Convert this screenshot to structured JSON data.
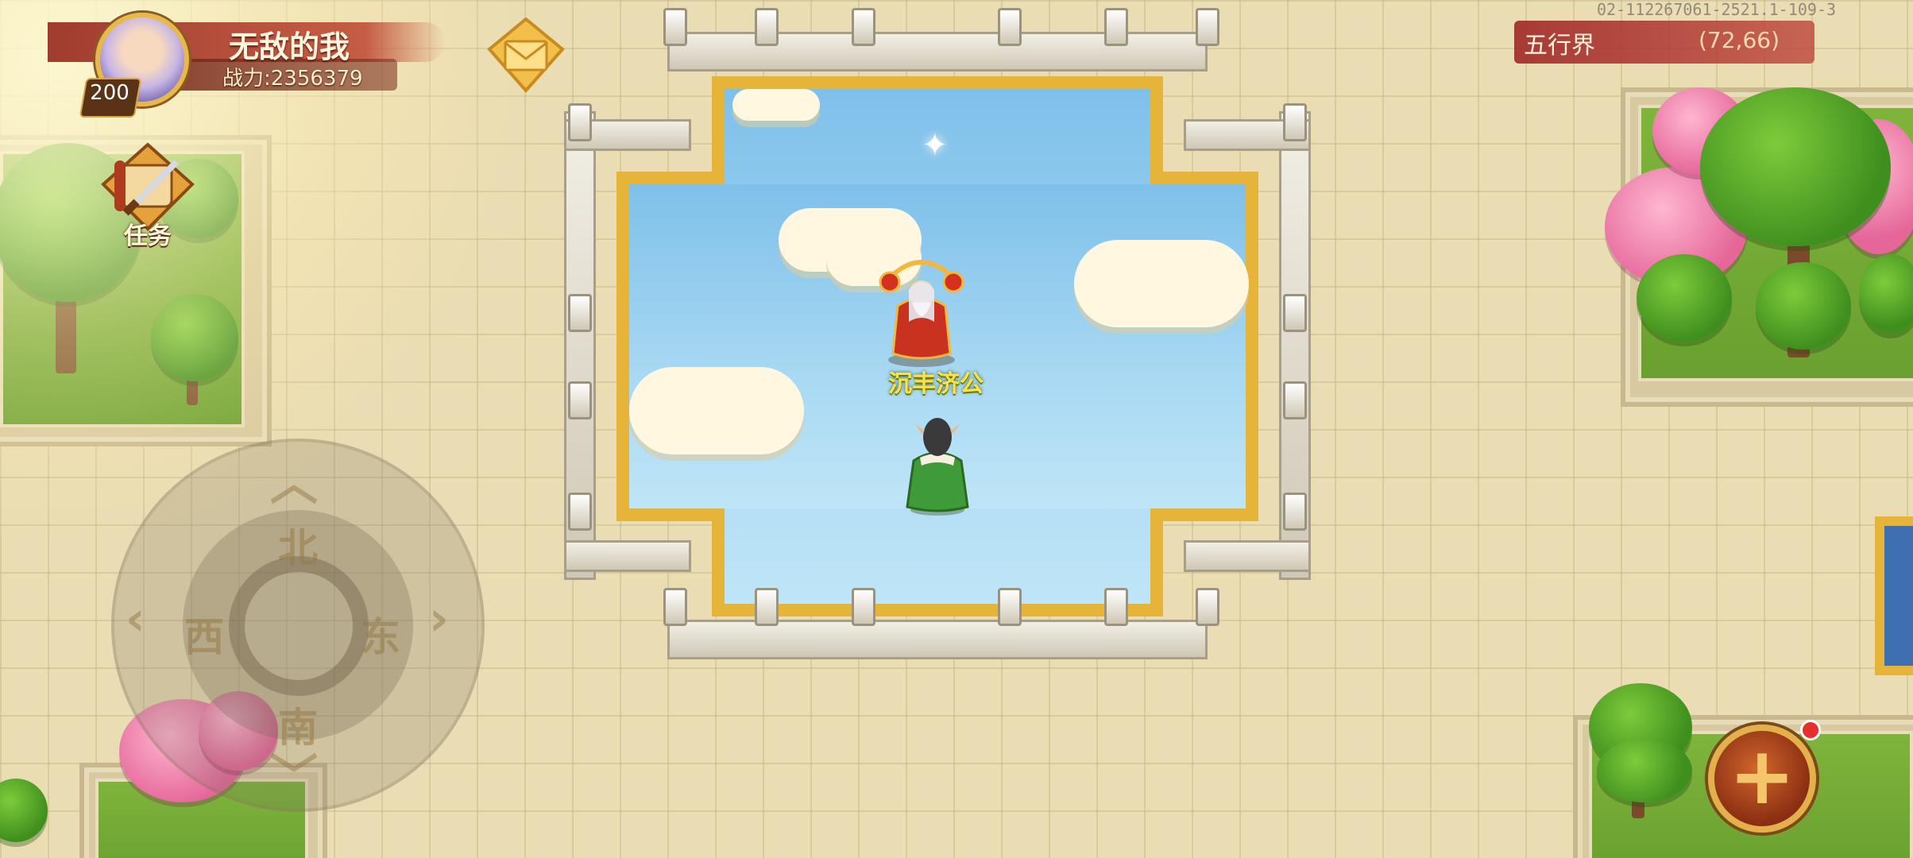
{
  "player": {
    "name": "无敌的我",
    "power_label": "战力:2356379",
    "level": "200"
  },
  "quest": {
    "label": "任务"
  },
  "location": {
    "map_name": "五行界",
    "coords": "(72,66)"
  },
  "debug": {
    "id_text": "02-112267061-2521.1-109-3"
  },
  "npc": {
    "name": "沉丰济公"
  },
  "joystick": {
    "north": "北",
    "south": "南",
    "east": "东",
    "west": "西"
  },
  "icons": {
    "mail": "envelope-icon",
    "quest": "scroll-sword-icon",
    "menu": "plus-icon",
    "notification": "red-dot-icon"
  },
  "colors": {
    "banner_red": "#a8342a",
    "gold": "#e7b43a",
    "npc_label": "#ffe04a",
    "sky": "#7fc0ea"
  }
}
